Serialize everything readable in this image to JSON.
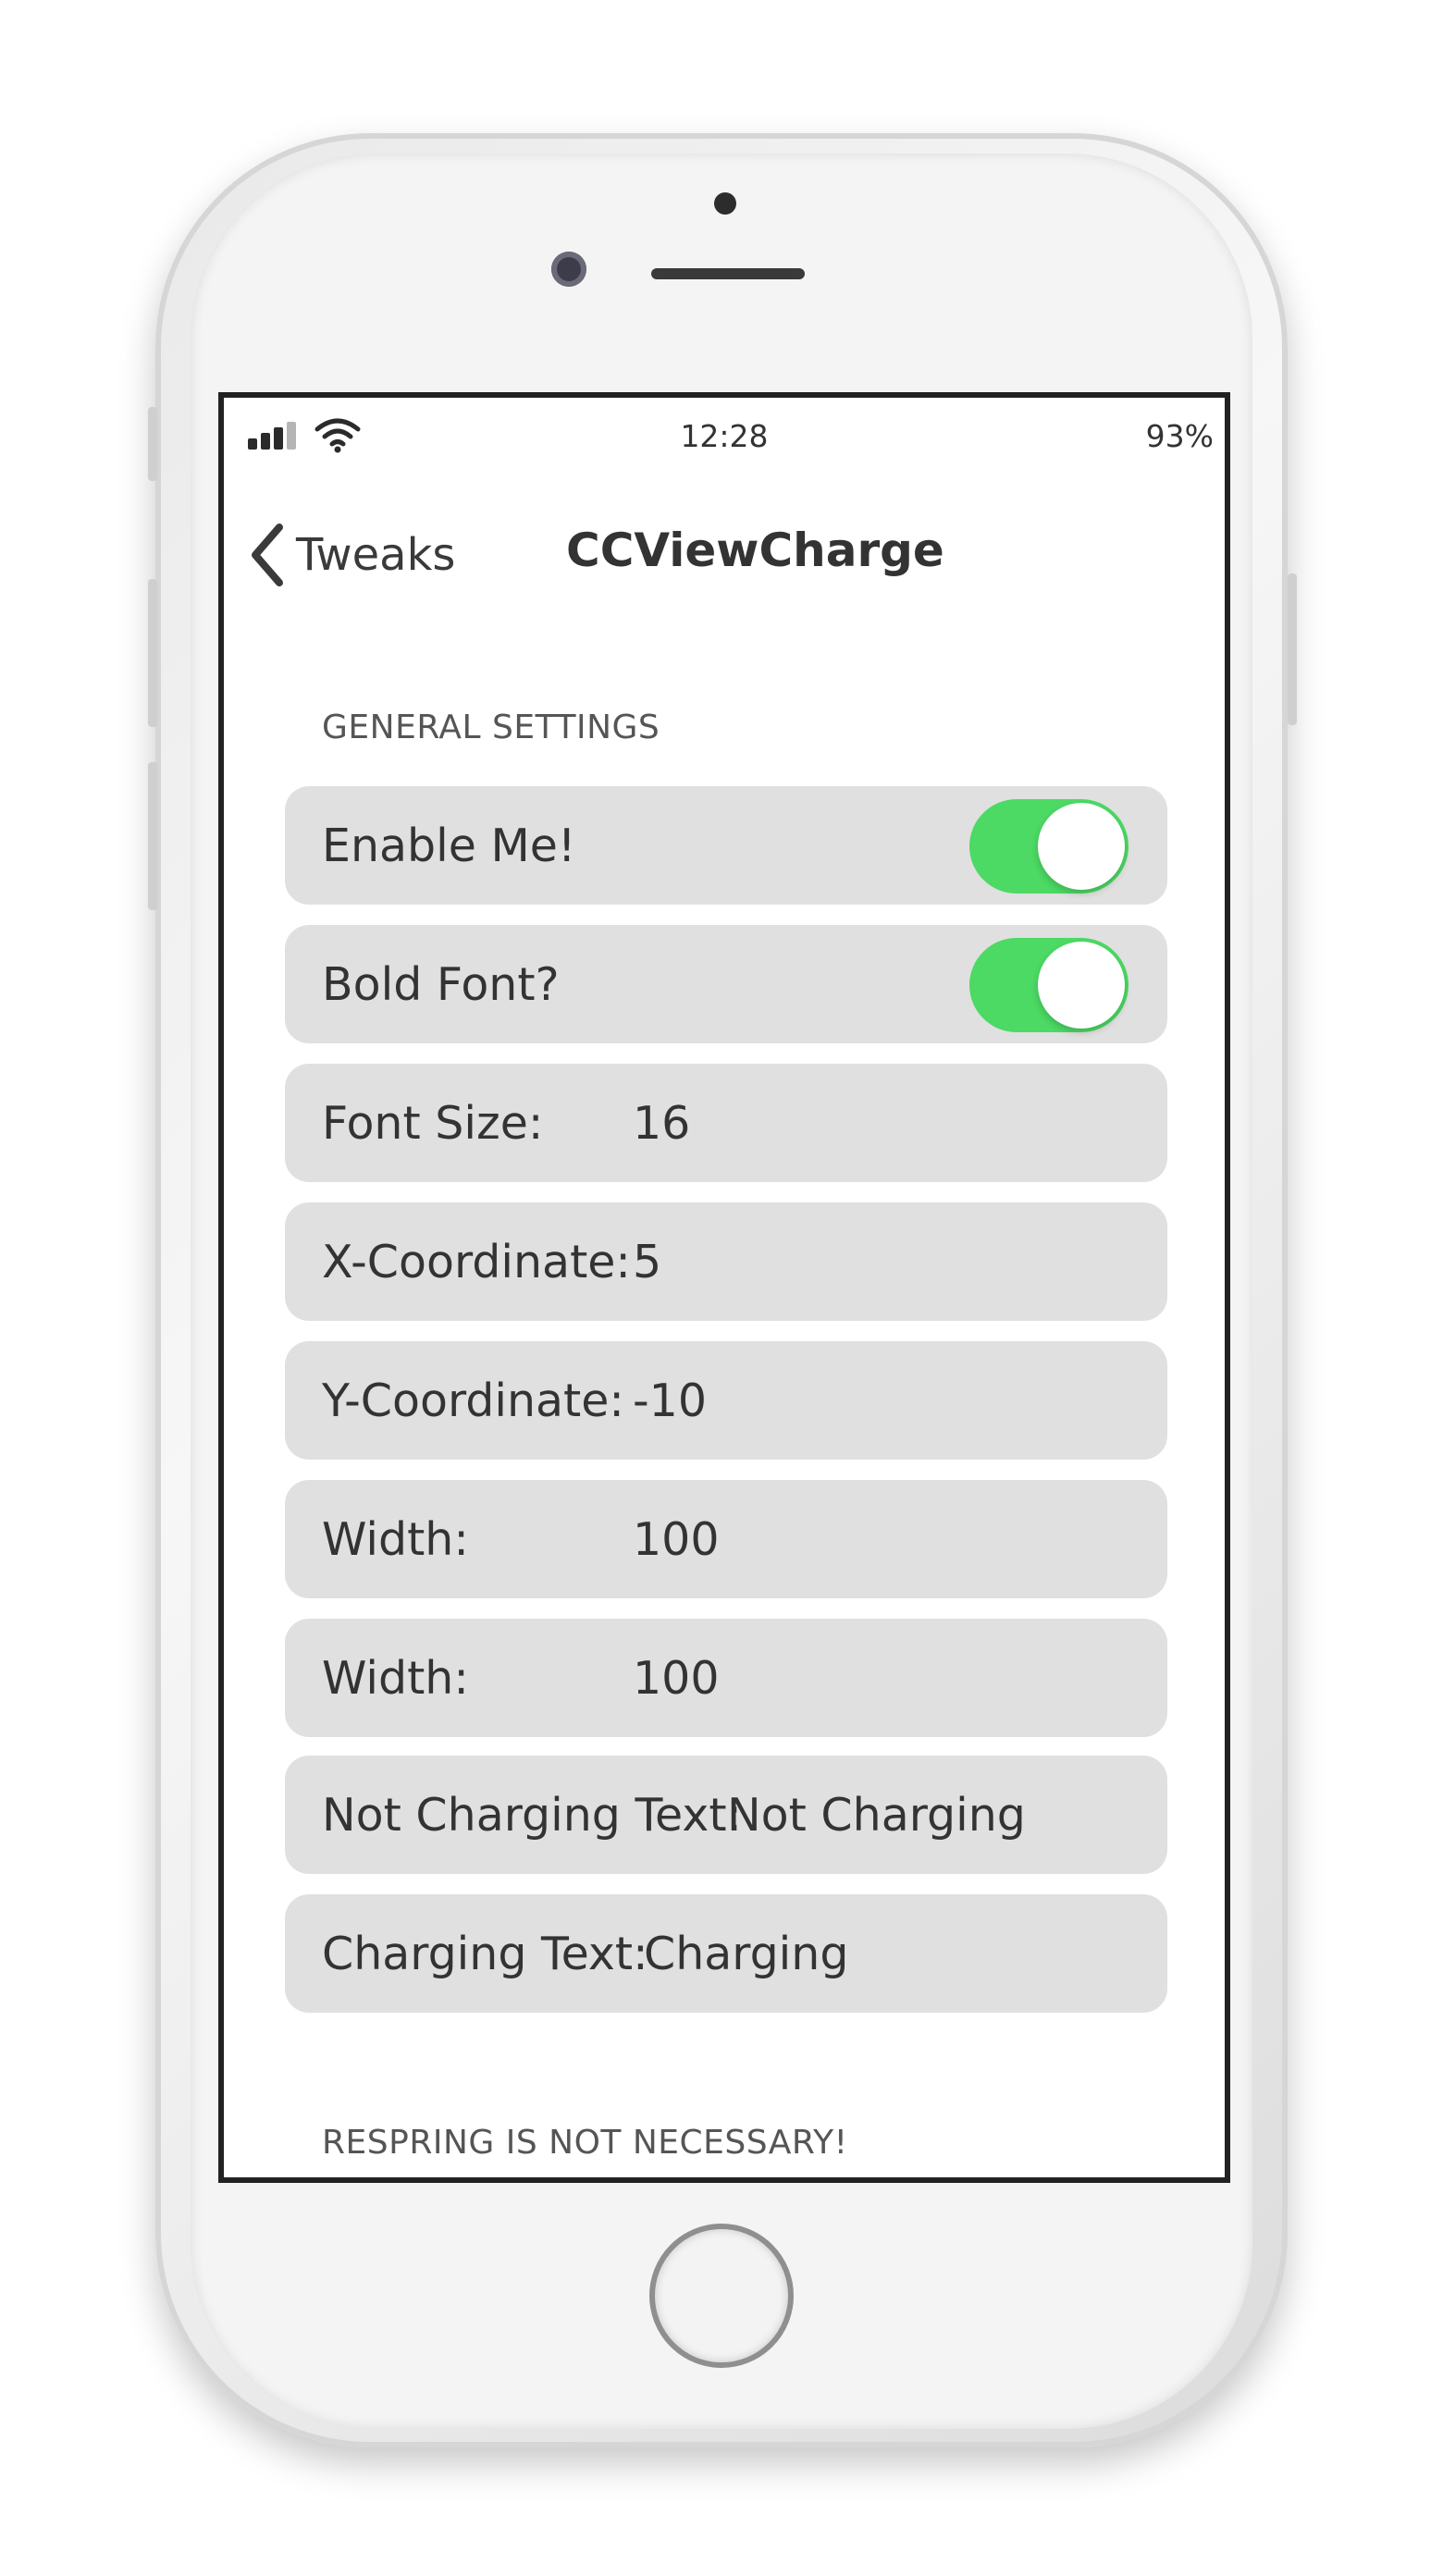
{
  "status_bar": {
    "time": "12:28",
    "battery": "93%",
    "signal_icon": "cellular-signal-icon",
    "wifi_icon": "wifi-icon"
  },
  "nav": {
    "back_label": "Tweaks",
    "title": "CCViewCharge",
    "back_icon": "chevron-left-icon"
  },
  "sections": {
    "general_header": "GENERAL SETTINGS",
    "footer": "RESPRING IS NOT NECESSARY!"
  },
  "settings": {
    "enable": {
      "label": "Enable Me!",
      "on": true
    },
    "bold_font": {
      "label": "Bold Font?",
      "on": true
    },
    "font_size": {
      "label": "Font Size:",
      "value": "16"
    },
    "x_coordinate": {
      "label": "X-Coordinate:",
      "value": "5"
    },
    "y_coordinate": {
      "label": "Y-Coordinate:",
      "value": "-10"
    },
    "width_1": {
      "label": "Width:",
      "value": "100"
    },
    "width_2": {
      "label": "Width:",
      "value": "100"
    },
    "not_charging_text": {
      "label": "Not Charging Text:",
      "value": "Not Charging"
    },
    "charging_text": {
      "label": "Charging Text:",
      "value": "Charging"
    }
  },
  "colors": {
    "toggle_on": "#4cd964",
    "cell_background": "#e0e0e0"
  }
}
